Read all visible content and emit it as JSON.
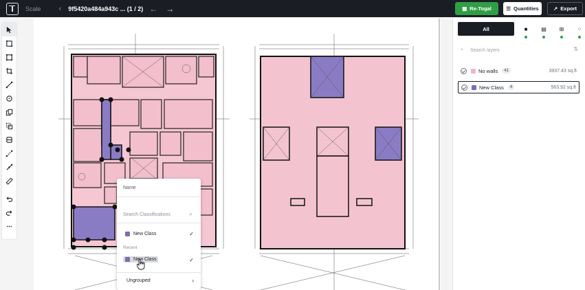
{
  "topbar": {
    "scale_label": "Scale",
    "doc_title": "9f5420a484a943c ... (1 / 2)",
    "retogal_label": "Re-Togal",
    "quantities_label": "Quantities",
    "export_label": "Export"
  },
  "tools": [
    "cursor-icon",
    "rectangle-icon",
    "polygon-icon",
    "crop-icon",
    "line-icon",
    "circle-icon",
    "copy-icon",
    "merge-icon",
    "wall-icon",
    "segment-icon",
    "measure-icon",
    "ruler-icon",
    "undo-icon",
    "redo-icon",
    "more-icon"
  ],
  "right_panel": {
    "tab_all": "All",
    "search_placeholder": "Search layers",
    "layers": [
      {
        "name": "No walls",
        "count": "41",
        "area": "3937.43 sq.ft",
        "color": "#f3b5c4"
      },
      {
        "name": "New Class",
        "count": "4",
        "area": "563.92 sq.ft",
        "color": "#7b6fb0"
      }
    ]
  },
  "popup": {
    "name_label": "Name",
    "search_placeholder": "Search Classifications",
    "current_class": "New Class",
    "recent_label": "Recent",
    "recent_class": "New Class",
    "ungrouped_label": "Ungrouped"
  },
  "colors": {
    "room_pink": "#f3c4d0",
    "room_purple": "#8a7cc4",
    "accent_green": "#2f9e44",
    "dark": "#1a1e24"
  }
}
